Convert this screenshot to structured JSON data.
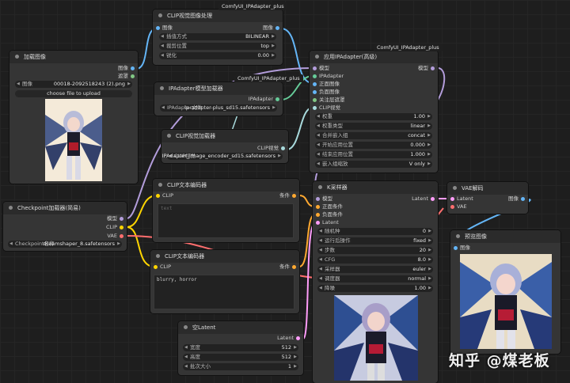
{
  "nodes": {
    "clip_vision_preprocess": {
      "title": "CLIP视觉图像处理",
      "badge": "ComfyUI_IPAdapter_plus",
      "input_image": "图像",
      "output_image": "图像",
      "widgets": [
        {
          "label": "插值方式",
          "value": "BILINEAR"
        },
        {
          "label": "裁剪位置",
          "value": "top"
        },
        {
          "label": "锐化",
          "value": "0.00"
        }
      ]
    },
    "load_image": {
      "title": "加载图像",
      "output_image": "图像",
      "output_mask": "遮罩",
      "image_label": "图像",
      "image_file": "00018-2092518243 (2).png",
      "upload_button": "choose file to upload"
    },
    "ipadapter_model_loader": {
      "title": "IPAdapter模型加载器",
      "badge": "ComfyUI_IPAdapter_plus",
      "output": "IPAdapter",
      "widget_label": "IPAdapter文件",
      "widget_value": "ip-adapter-plus_sd15.safetensors"
    },
    "clip_vision_loader": {
      "title": "CLIP视觉加载器",
      "output": "CLIP视觉",
      "widget_label": "CLIP视觉",
      "widget_value": "IPAdapter_image_encoder_sd15.safetensors"
    },
    "apply_ipadapter": {
      "title": "应用IPAdapter(高级)",
      "badge": "ComfyUI_IPAdapter_plus",
      "inputs": [
        "模型",
        "IPAdapter",
        "正面图像",
        "负面图像",
        "关注层遮罩",
        "CLIP视觉"
      ],
      "output": "模型",
      "widgets": [
        {
          "label": "权重",
          "value": "1.00"
        },
        {
          "label": "权重类型",
          "value": "linear"
        },
        {
          "label": "合并嵌入组",
          "value": "concat"
        },
        {
          "label": "开始应用位置",
          "value": "0.000"
        },
        {
          "label": "结束应用位置",
          "value": "1.000"
        },
        {
          "label": "嵌入组缩放",
          "value": "V only"
        }
      ]
    },
    "checkpoint_loader": {
      "title": "Checkpoint加载器(简易)",
      "outputs": [
        "模型",
        "CLIP",
        "VAE"
      ],
      "widget_label": "Checkpoint名称",
      "widget_value": "dreamshaper_8.safetensors"
    },
    "clip_text_positive": {
      "title": "CLIP文本编码器",
      "input": "CLIP",
      "output": "条件",
      "text": "text"
    },
    "clip_text_negative": {
      "title": "CLIP文本编码器",
      "input": "CLIP",
      "output": "条件",
      "text": "blurry, horror"
    },
    "ksampler": {
      "title": "K采样器",
      "inputs": [
        "模型",
        "正面条件",
        "负面条件",
        "Latent"
      ],
      "output": "Latent",
      "widgets": [
        {
          "label": "随机种",
          "value": "0"
        },
        {
          "label": "运行后操作",
          "value": "fixed"
        },
        {
          "label": "步数",
          "value": "20"
        },
        {
          "label": "CFG",
          "value": "8.0"
        },
        {
          "label": "采样器",
          "value": "euler"
        },
        {
          "label": "调度器",
          "value": "normal"
        },
        {
          "label": "降噪",
          "value": "1.00"
        }
      ]
    },
    "vae_decode": {
      "title": "VAE解码",
      "inputs": [
        "Latent",
        "VAE"
      ],
      "output": "图像"
    },
    "preview_image": {
      "title": "预览图像",
      "input": "图像"
    },
    "empty_latent": {
      "title": "空Latent",
      "output": "Latent",
      "widgets": [
        {
          "label": "宽度",
          "value": "512"
        },
        {
          "label": "高度",
          "value": "512"
        },
        {
          "label": "批次大小",
          "value": "1"
        }
      ]
    }
  },
  "watermark": "知乎 @煤老板",
  "colors": {
    "model": "#b39ddb",
    "clip": "#ffd500",
    "vae": "#ff6e6e",
    "image": "#64b5f6",
    "conditioning": "#ffa931",
    "latent": "#ff9cf9",
    "ipadapter": "#66cc99",
    "clip_vision": "#a8dadc",
    "mask": "#81c784"
  }
}
